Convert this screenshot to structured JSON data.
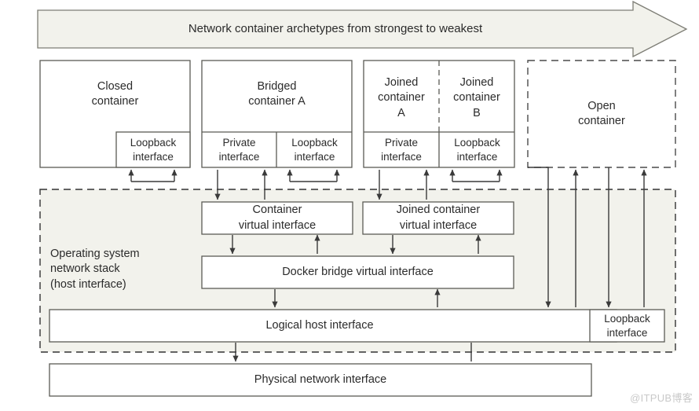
{
  "banner": {
    "text": "Network container archetypes from strongest to weakest",
    "fill": "#f2f2ec",
    "stroke": "#7d7d75"
  },
  "colors": {
    "box_fill": "#ffffff",
    "box_stroke": "#5b5b55",
    "panel_fill": "#f2f2ec",
    "panel_stroke": "#333333",
    "arrow": "#3a3a3a",
    "text": "#2b2b2b",
    "watermark": "#c9c9c9"
  },
  "containers": [
    {
      "name": "closed-container",
      "title": "Closed\ncontainer",
      "interfaces": [
        {
          "name": "loopback-interface",
          "label": "Loopback\ninterface"
        }
      ]
    },
    {
      "name": "bridged-container-a",
      "title": "Bridged\ncontainer A",
      "interfaces": [
        {
          "name": "private-interface",
          "label": "Private\ninterface"
        },
        {
          "name": "loopback-interface",
          "label": "Loopback\ninterface"
        }
      ]
    },
    {
      "name": "joined-container-a",
      "title": "Joined\ncontainer\nA",
      "interfaces": [
        {
          "name": "private-interface",
          "label": "Private\ninterface"
        }
      ]
    },
    {
      "name": "joined-container-b",
      "title": "Joined\ncontainer\nB",
      "interfaces": [
        {
          "name": "loopback-interface",
          "label": "Loopback\ninterface"
        }
      ]
    },
    {
      "name": "open-container",
      "title": "Open\ncontainer",
      "interfaces": []
    }
  ],
  "os_stack": {
    "label": "Operating system\nnetwork stack\n(host interface)",
    "boxes": [
      {
        "name": "container-virtual-interface",
        "label": "Container\nvirtual interface"
      },
      {
        "name": "joined-container-virtual-interface",
        "label": "Joined container\nvirtual interface"
      },
      {
        "name": "docker-bridge-virtual-interface",
        "label": "Docker bridge virtual interface"
      },
      {
        "name": "logical-host-interface",
        "label": "Logical host interface"
      },
      {
        "name": "host-loopback-interface",
        "label": "Loopback\ninterface"
      }
    ]
  },
  "physical": {
    "label": "Physical network interface"
  },
  "watermark": "@ITPUB博客"
}
